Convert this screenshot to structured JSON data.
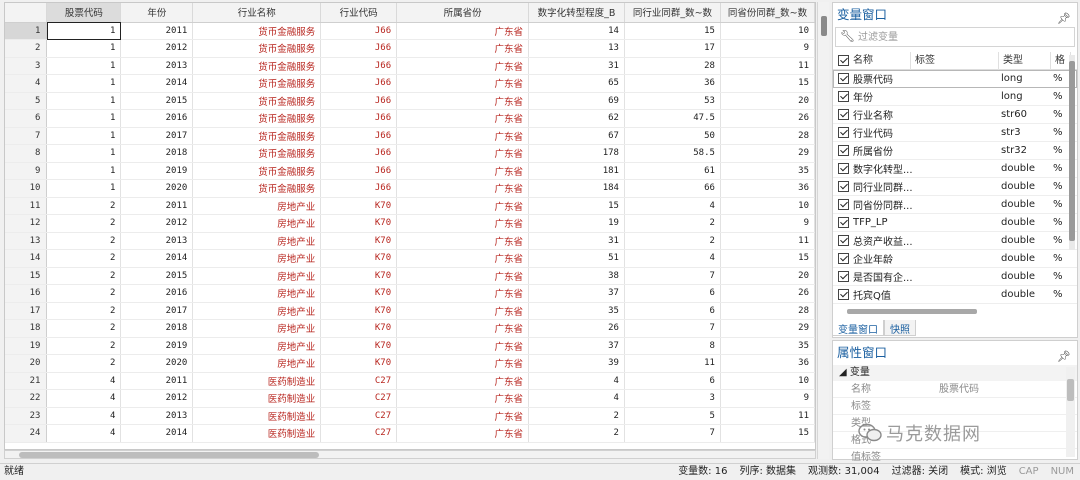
{
  "grid": {
    "columns": [
      "股票代码",
      "年份",
      "行业名称",
      "行业代码",
      "所属省份",
      "数字化转型程度_B",
      "同行业同群_数~数",
      "同省份同群_数~数"
    ],
    "rows": [
      {
        "n": "1",
        "c": [
          "1",
          "2011",
          "货币金融服务",
          "J66",
          "广东省",
          "14",
          "15",
          "10"
        ]
      },
      {
        "n": "2",
        "c": [
          "1",
          "2012",
          "货币金融服务",
          "J66",
          "广东省",
          "13",
          "17",
          "9"
        ]
      },
      {
        "n": "3",
        "c": [
          "1",
          "2013",
          "货币金融服务",
          "J66",
          "广东省",
          "31",
          "28",
          "11"
        ]
      },
      {
        "n": "4",
        "c": [
          "1",
          "2014",
          "货币金融服务",
          "J66",
          "广东省",
          "65",
          "36",
          "15"
        ]
      },
      {
        "n": "5",
        "c": [
          "1",
          "2015",
          "货币金融服务",
          "J66",
          "广东省",
          "69",
          "53",
          "20"
        ]
      },
      {
        "n": "6",
        "c": [
          "1",
          "2016",
          "货币金融服务",
          "J66",
          "广东省",
          "62",
          "47.5",
          "26"
        ]
      },
      {
        "n": "7",
        "c": [
          "1",
          "2017",
          "货币金融服务",
          "J66",
          "广东省",
          "67",
          "50",
          "28"
        ]
      },
      {
        "n": "8",
        "c": [
          "1",
          "2018",
          "货币金融服务",
          "J66",
          "广东省",
          "178",
          "58.5",
          "29"
        ]
      },
      {
        "n": "9",
        "c": [
          "1",
          "2019",
          "货币金融服务",
          "J66",
          "广东省",
          "181",
          "61",
          "35"
        ]
      },
      {
        "n": "10",
        "c": [
          "1",
          "2020",
          "货币金融服务",
          "J66",
          "广东省",
          "184",
          "66",
          "36"
        ]
      },
      {
        "n": "11",
        "c": [
          "2",
          "2011",
          "房地产业",
          "K70",
          "广东省",
          "15",
          "4",
          "10"
        ]
      },
      {
        "n": "12",
        "c": [
          "2",
          "2012",
          "房地产业",
          "K70",
          "广东省",
          "19",
          "2",
          "9"
        ]
      },
      {
        "n": "13",
        "c": [
          "2",
          "2013",
          "房地产业",
          "K70",
          "广东省",
          "31",
          "2",
          "11"
        ]
      },
      {
        "n": "14",
        "c": [
          "2",
          "2014",
          "房地产业",
          "K70",
          "广东省",
          "51",
          "4",
          "15"
        ]
      },
      {
        "n": "15",
        "c": [
          "2",
          "2015",
          "房地产业",
          "K70",
          "广东省",
          "38",
          "7",
          "20"
        ]
      },
      {
        "n": "16",
        "c": [
          "2",
          "2016",
          "房地产业",
          "K70",
          "广东省",
          "37",
          "6",
          "26"
        ]
      },
      {
        "n": "17",
        "c": [
          "2",
          "2017",
          "房地产业",
          "K70",
          "广东省",
          "35",
          "6",
          "28"
        ]
      },
      {
        "n": "18",
        "c": [
          "2",
          "2018",
          "房地产业",
          "K70",
          "广东省",
          "26",
          "7",
          "29"
        ]
      },
      {
        "n": "19",
        "c": [
          "2",
          "2019",
          "房地产业",
          "K70",
          "广东省",
          "37",
          "8",
          "35"
        ]
      },
      {
        "n": "20",
        "c": [
          "2",
          "2020",
          "房地产业",
          "K70",
          "广东省",
          "39",
          "11",
          "36"
        ]
      },
      {
        "n": "21",
        "c": [
          "4",
          "2011",
          "医药制造业",
          "C27",
          "广东省",
          "4",
          "6",
          "10"
        ]
      },
      {
        "n": "22",
        "c": [
          "4",
          "2012",
          "医药制造业",
          "C27",
          "广东省",
          "4",
          "3",
          "9"
        ]
      },
      {
        "n": "23",
        "c": [
          "4",
          "2013",
          "医药制造业",
          "C27",
          "广东省",
          "2",
          "5",
          "11"
        ]
      },
      {
        "n": "24",
        "c": [
          "4",
          "2014",
          "医药制造业",
          "C27",
          "广东省",
          "2",
          "7",
          "15"
        ]
      }
    ]
  },
  "variables_panel": {
    "title": "变量窗口",
    "filter_placeholder": "过滤变量",
    "headers": {
      "name": "名称",
      "label": "标签",
      "type": "类型",
      "format": "格"
    },
    "items": [
      {
        "name": "股票代码",
        "type": "long",
        "fmt": "%"
      },
      {
        "name": "年份",
        "type": "long",
        "fmt": "%"
      },
      {
        "name": "行业名称",
        "type": "str60",
        "fmt": "%"
      },
      {
        "name": "行业代码",
        "type": "str3",
        "fmt": "%"
      },
      {
        "name": "所属省份",
        "type": "str32",
        "fmt": "%"
      },
      {
        "name": "数字化转型...",
        "type": "double",
        "fmt": "%"
      },
      {
        "name": "同行业同群...",
        "type": "double",
        "fmt": "%"
      },
      {
        "name": "同省份同群...",
        "type": "double",
        "fmt": "%"
      },
      {
        "name": "TFP_LP",
        "type": "double",
        "fmt": "%"
      },
      {
        "name": "总资产收益...",
        "type": "double",
        "fmt": "%"
      },
      {
        "name": "企业年龄",
        "type": "double",
        "fmt": "%"
      },
      {
        "name": "是否国有企...",
        "type": "double",
        "fmt": "%"
      },
      {
        "name": "托宾Q值",
        "type": "double",
        "fmt": "%"
      }
    ]
  },
  "tabs": [
    "变量窗口",
    "快照"
  ],
  "properties_panel": {
    "title": "属性窗口",
    "section": "变量",
    "rows": [
      {
        "k": "名称",
        "v": "股票代码"
      },
      {
        "k": "标签",
        "v": ""
      },
      {
        "k": "类型",
        "v": ""
      },
      {
        "k": "格式",
        "v": ""
      },
      {
        "k": "值标签",
        "v": ""
      }
    ]
  },
  "watermark": "马克数据网",
  "status": {
    "ready": "就绪",
    "vars": "变量数: 16",
    "order": "列序: 数据集",
    "obs": "观测数: 31,004",
    "filter": "过滤器: 关闭",
    "mode": "模式: 浏览",
    "cap": "CAP",
    "num": "NUM"
  }
}
